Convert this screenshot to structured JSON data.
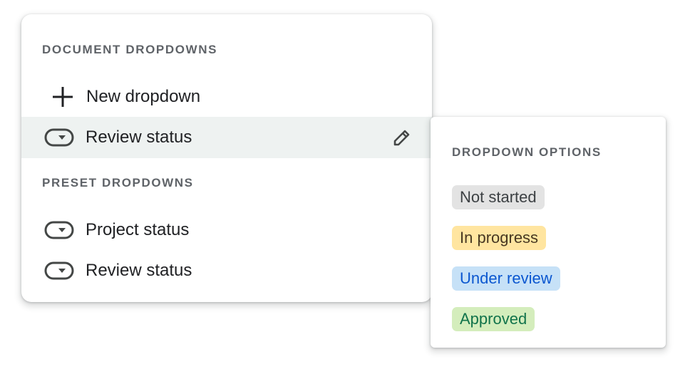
{
  "document_section": {
    "header": "DOCUMENT DROPDOWNS",
    "new_dropdown_label": "New dropdown",
    "items": [
      {
        "label": "Review status",
        "icon": "dropdown-chip-icon",
        "selected": true
      }
    ],
    "edit_icon": "pencil-icon"
  },
  "preset_section": {
    "header": "PRESET DROPDOWNS",
    "items": [
      {
        "label": "Project status",
        "icon": "dropdown-chip-icon"
      },
      {
        "label": "Review status",
        "icon": "dropdown-chip-icon"
      }
    ]
  },
  "options_panel": {
    "header": "DROPDOWN OPTIONS",
    "options": [
      {
        "label": "Not started",
        "bg": "#e3e3e3",
        "fg": "#3c4043"
      },
      {
        "label": "In progress",
        "bg": "#ffe5a0",
        "fg": "#473822"
      },
      {
        "label": "Under review",
        "bg": "#c6e1f7",
        "fg": "#0b57d0"
      },
      {
        "label": "Approved",
        "bg": "#d4edbc",
        "fg": "#11734b"
      }
    ]
  },
  "colors": {
    "selected_row_bg": "#eef2f1",
    "header_text": "#5f6368",
    "body_text": "#202124",
    "icon": "#444746"
  }
}
